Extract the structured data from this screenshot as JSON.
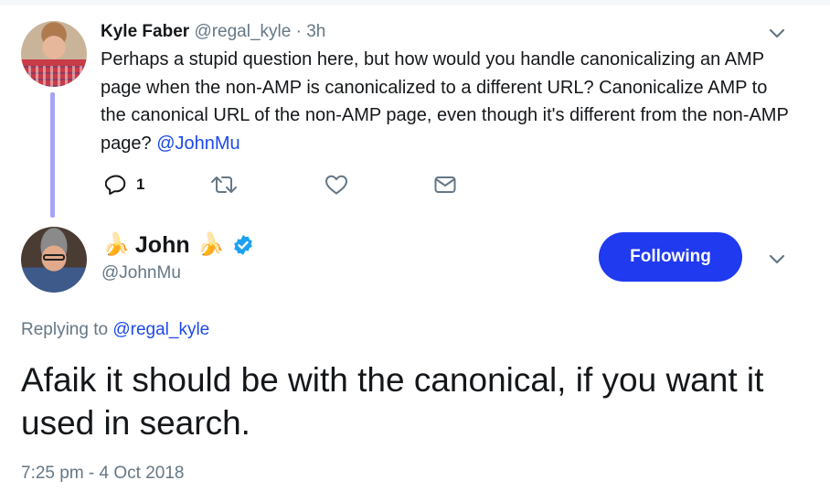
{
  "parent_tweet": {
    "author_name": "Kyle Faber",
    "author_handle": "@regal_kyle",
    "separator": "·",
    "time": "3h",
    "text": "Perhaps a stupid question here, but how would you handle canonicalizing an AMP page when the non-AMP is canonicalized to a different URL? Canonicalize AMP to the canonical URL of the non-AMP page, even though it's different from the non-AMP page?",
    "mention": "@JohnMu",
    "reply_count": "1",
    "actions": [
      "reply-icon",
      "retweet-icon",
      "like-icon",
      "direct-message-icon"
    ]
  },
  "main_tweet": {
    "author_name": "John",
    "emoji": "🍌",
    "author_handle": "@JohnMu",
    "verified": true,
    "follow_label": "Following",
    "replying_prefix": "Replying to",
    "replying_to": "@regal_kyle",
    "text": "Afaik it should be with the canonical, if you want it used in search.",
    "timestamp": "7:25 pm - 4 Oct 2018"
  },
  "colors": {
    "accent": "#1f3aef",
    "mention": "#1b49ec",
    "thread_line": "#a7a3f5",
    "secondary_text": "#657786",
    "verified": "#1da1f2"
  }
}
